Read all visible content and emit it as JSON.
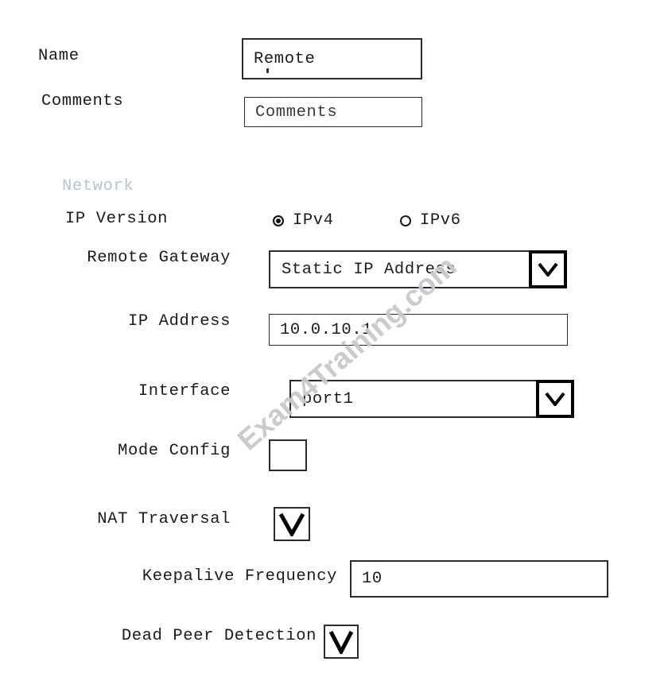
{
  "form": {
    "name": {
      "label": "Name",
      "value": "Remote"
    },
    "comments": {
      "label": "Comments",
      "value": "Comments",
      "placeholder": "Comments"
    }
  },
  "network": {
    "section_title": "Network",
    "section_title_color": "#b9c4cf",
    "ip_version": {
      "label": "IP Version",
      "selected": "IPv4",
      "options": [
        {
          "label": "IPv4",
          "checked": true
        },
        {
          "label": "IPv6",
          "checked": false
        }
      ]
    },
    "remote_gateway": {
      "label": "Remote Gateway",
      "value": "Static IP Address",
      "icon": "chevron-down-icon"
    },
    "ip_address": {
      "label": "IP Address",
      "value": "10.0.10.1"
    },
    "interface": {
      "label": "Interface",
      "value": "port1",
      "icon": "chevron-down-icon"
    },
    "mode_config": {
      "label": "Mode Config",
      "checked": false,
      "icon": "checkbox-empty-icon"
    },
    "nat_traversal": {
      "label": "NAT Traversal",
      "checked": true,
      "icon": "checkbox-checked-icon"
    },
    "keepalive_frequency": {
      "label": "Keepalive Frequency",
      "value": "10"
    },
    "dead_peer_detection": {
      "label": "Dead Peer Detection",
      "checked": true,
      "icon": "checkbox-checked-icon"
    }
  },
  "watermark": {
    "text": "Exam4Training.com",
    "color": "#c9c9cd"
  }
}
